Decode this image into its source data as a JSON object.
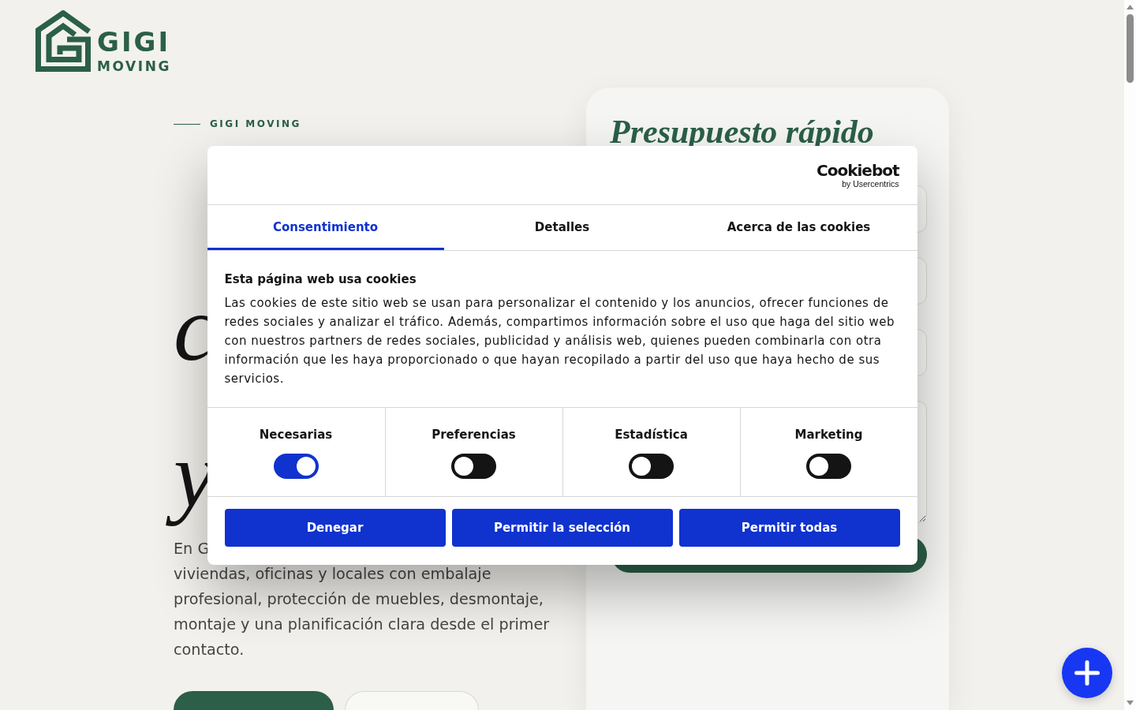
{
  "header": {
    "logo": {
      "name": "GIGI",
      "tagline": "MOVING"
    }
  },
  "hero": {
    "eyebrow": "GIGI MOVING",
    "heading_fragments": [
      {
        "text": "c"
      },
      {
        "text": "y"
      }
    ],
    "intro": {
      "first_line": "En G",
      "rest": "viviendas, oficinas y locales con embalaje profesional, protección de muebles, desmontaje, montaje y una planificación clara desde el primer contacto."
    },
    "buttons": [
      {
        "kind": "primary"
      },
      {
        "kind": "secondary"
      }
    ]
  },
  "quote_form": {
    "title": "Presupuesto rápido",
    "fields": [
      {
        "kind": "input"
      },
      {
        "kind": "input"
      },
      {
        "kind": "input"
      },
      {
        "kind": "textarea"
      }
    ]
  },
  "cookie_dialog": {
    "brand": {
      "name": "Cookiebot",
      "byline": "by Usercentrics"
    },
    "tabs": [
      {
        "label": "Consentimiento",
        "selected": true
      },
      {
        "label": "Detalles",
        "selected": false
      },
      {
        "label": "Acerca de las cookies",
        "selected": false
      }
    ],
    "title": "Esta página web usa cookies",
    "text": "Las cookies de este sitio web se usan para personalizar el contenido y los anuncios, ofrecer funciones de redes sociales y analizar el tráfico. Además, compartimos información sobre el uso que haga del sitio web con nuestros partners de redes sociales, publicidad y análisis web, quienes pueden combinarla con otra información que les haya proporcionado o que hayan recopilado a partir del uso que haya hecho de sus servicios.",
    "categories": [
      {
        "label": "Necesarias",
        "on": true
      },
      {
        "label": "Preferencias",
        "on": false
      },
      {
        "label": "Estadística",
        "on": false
      },
      {
        "label": "Marketing",
        "on": false
      }
    ],
    "buttons": [
      "Denegar",
      "Permitir la selección",
      "Permitir todas"
    ]
  }
}
